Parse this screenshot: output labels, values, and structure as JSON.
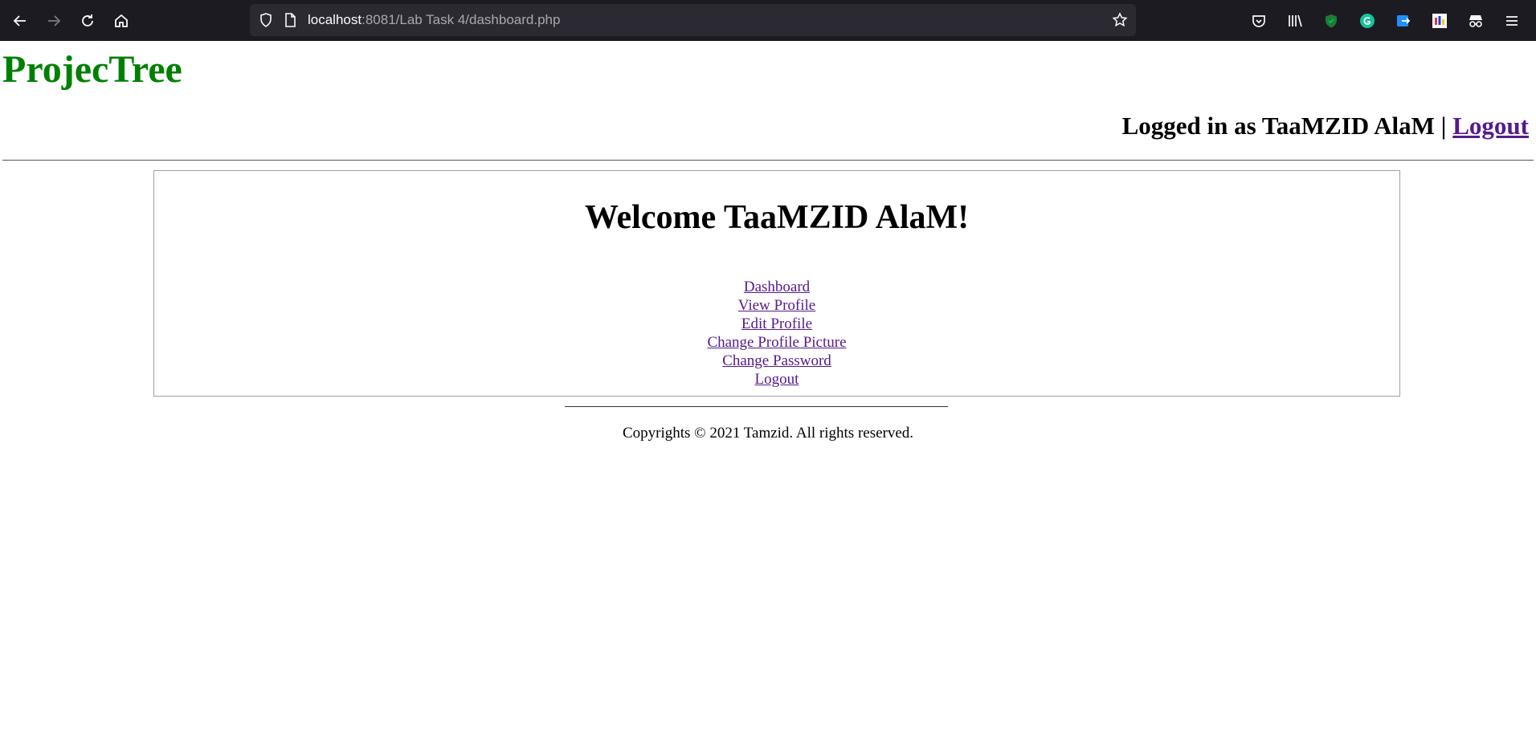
{
  "browser": {
    "url_host": "localhost",
    "url_rest": ":8081/Lab Task 4/dashboard.php",
    "nav_icons": [
      "back-arrow-icon",
      "forward-arrow-icon",
      "reload-icon",
      "home-icon"
    ],
    "right_icons": [
      "pocket-icon",
      "library-icon",
      "shield-extension-icon",
      "grammarly-icon",
      "share-extension-icon",
      "color-extension-icon",
      "incognito-icon",
      "hamburger-menu-icon"
    ]
  },
  "site": {
    "logo": "ProjecTree",
    "logged_in_text": "Logged in as TaaMZID AlaM | ",
    "logout_label": "Logout"
  },
  "main": {
    "welcome": "Welcome TaaMZID AlaM!",
    "menu": [
      {
        "label": "Dashboard"
      },
      {
        "label": "View Profile"
      },
      {
        "label": "Edit Profile"
      },
      {
        "label": "Change Profile Picture"
      },
      {
        "label": "Change Password"
      },
      {
        "label": "Logout"
      }
    ]
  },
  "footer": {
    "copyright": "Copyrights © 2021 Tamzid. All rights reserved."
  },
  "colors": {
    "toolbar_bg": "#1c1b22",
    "urlbar_bg": "#2b2a33",
    "logo": "#008000",
    "link_visited": "#551a8b"
  }
}
